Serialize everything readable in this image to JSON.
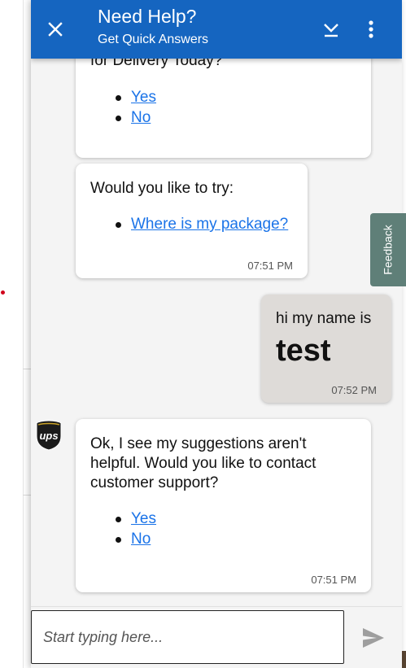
{
  "header": {
    "title": "Need Help?",
    "subtitle": "Get Quick Answers",
    "close_icon": "close-icon",
    "minimize_icon": "minimize-icon",
    "menu_icon": "more-vert-icon",
    "color": "#1565c0"
  },
  "messages": [
    {
      "from": "bot",
      "text": "for Delivery Today?",
      "options": [
        "Yes",
        "No"
      ]
    },
    {
      "from": "bot",
      "text": "Would you like to try:",
      "options": [
        "Where is my package?"
      ],
      "time": "07:51 PM"
    },
    {
      "from": "user",
      "text": "hi my name is",
      "big_text": "test",
      "time": "07:52 PM"
    },
    {
      "from": "bot",
      "text": "Ok, I see my suggestions aren't helpful. Would you like to contact customer support?",
      "options": [
        "Yes",
        "No"
      ],
      "time": "07:51 PM",
      "avatar": "ups"
    }
  ],
  "feedback": {
    "label": "Feedback",
    "color": "#5f7f78"
  },
  "composer": {
    "placeholder": "Start typing here...",
    "value": "",
    "send_icon": "send-icon"
  }
}
